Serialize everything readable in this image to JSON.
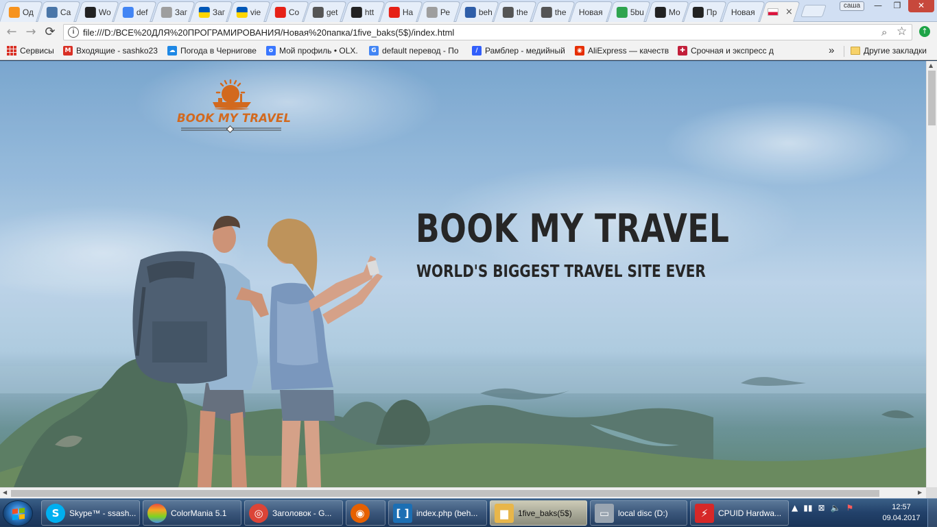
{
  "browser": {
    "tabs": [
      {
        "title": "Од",
        "icon": "odnoklassniki-icon",
        "color": "#f7931e"
      },
      {
        "title": "Са",
        "icon": "vk-icon",
        "color": "#4a76a8"
      },
      {
        "title": "Wo",
        "icon": "github-icon",
        "color": "#222222"
      },
      {
        "title": "def",
        "icon": "google-icon",
        "color": "#4285f4"
      },
      {
        "title": "Заг",
        "icon": "document-icon",
        "color": "#9e9e9e"
      },
      {
        "title": "Заг",
        "icon": "ukraine-flag-icon",
        "color": "#ffd500"
      },
      {
        "title": "vie",
        "icon": "ukraine-flag-icon",
        "color": "#ffd500"
      },
      {
        "title": "Со",
        "icon": "youtube-icon",
        "color": "#e62117"
      },
      {
        "title": "get",
        "icon": "w-mark-icon",
        "color": "#555555"
      },
      {
        "title": "htt",
        "icon": "github-icon",
        "color": "#222222"
      },
      {
        "title": "На",
        "icon": "youtube-icon",
        "color": "#e62117"
      },
      {
        "title": "Ре",
        "icon": "document-icon",
        "color": "#9e9e9e"
      },
      {
        "title": "beh",
        "icon": "audio-wave-icon",
        "color": "#2f5ea8"
      },
      {
        "title": "the",
        "icon": "w-mark-icon",
        "color": "#555555"
      },
      {
        "title": "the",
        "icon": "w-mark-icon",
        "color": "#555555"
      },
      {
        "title": "Новая",
        "icon": "",
        "color": ""
      },
      {
        "title": "5bu",
        "icon": "dollar-badge-icon",
        "color": "#2ea44f"
      },
      {
        "title": "Мо",
        "icon": "k-logo-icon",
        "color": "#222222"
      },
      {
        "title": "Пр",
        "icon": "k-logo-icon",
        "color": "#222222"
      },
      {
        "title": "Новая",
        "icon": "",
        "color": ""
      }
    ],
    "active_tab": {
      "icon": "poland-flag-icon",
      "close": "×"
    },
    "profile_button": "саша",
    "window_controls": {
      "minimize": "—",
      "restore": "❐",
      "close": "✕"
    },
    "nav": {
      "back": "←",
      "forward": "→",
      "reload": "⟳"
    },
    "address": {
      "url": "file:///D:/ВСЕ%20ДЛЯ%20ПРОГРАМИРОВАНИЯ/Новая%20папка/1five_baks(5$)/index.html",
      "info": "i",
      "zoom": "⌕",
      "star": "☆"
    },
    "extension": {
      "icon": "arrow-up-circle-icon",
      "glyph": "↑"
    },
    "bookmarks": [
      {
        "label": "Сервисы",
        "icon": "apps-icon",
        "color": "#d93025"
      },
      {
        "label": "Входящие - sashko23",
        "icon": "gmail-icon",
        "color": "#d93025",
        "glyph": "M"
      },
      {
        "label": "Погода в Чернигове",
        "icon": "weather-icon",
        "color": "#1e88e5",
        "glyph": "☁"
      },
      {
        "label": "Мой профиль • OLX.",
        "icon": "olx-icon",
        "color": "#3a77ff",
        "glyph": "o"
      },
      {
        "label": "default перевод - По",
        "icon": "google-icon",
        "color": "#4285f4",
        "glyph": "G"
      },
      {
        "label": "Рамблер - медийный",
        "icon": "rambler-icon",
        "color": "#315efb",
        "glyph": "/"
      },
      {
        "label": "AliExpress — качеств",
        "icon": "aliexpress-icon",
        "color": "#e62e04",
        "glyph": "◉"
      },
      {
        "label": "Срочная и экспресс д",
        "icon": "express-icon",
        "color": "#c21f3a",
        "glyph": "✚"
      }
    ],
    "bookmarks_overflow": "»",
    "other_bookmarks": "Другие закладки"
  },
  "page": {
    "logo_text": "BOOK MY TRAVEL",
    "hero_title": "BOOK MY TRAVEL",
    "hero_subtitle": "WORLD'S BIGGEST TRAVEL SITE EVER"
  },
  "taskbar": {
    "items": [
      {
        "label": "Skype™ - ssash...",
        "icon": "skype-icon",
        "color": "#00aff0",
        "glyph": "S"
      },
      {
        "label": "ColorMania 5.1",
        "icon": "colormania-icon",
        "color": "#e84b3c",
        "glyph": ""
      },
      {
        "label": "Заголовок - G...",
        "icon": "chrome-icon",
        "color": "#db4437",
        "glyph": "◎"
      },
      {
        "label": "",
        "icon": "firefox-icon",
        "color": "#e66000",
        "glyph": "◉"
      },
      {
        "label": "index.php (beh...",
        "icon": "brackets-icon",
        "color": "#1c6fb4",
        "glyph": "[ ]"
      },
      {
        "label": "1five_baks(5$)",
        "icon": "folder-icon",
        "color": "#e8b64a",
        "glyph": "▆"
      },
      {
        "label": "local disc (D:)",
        "icon": "drive-icon",
        "color": "#9aa5b1",
        "glyph": "▭"
      },
      {
        "label": "CPUID Hardwa...",
        "icon": "cpuid-icon",
        "color": "#d62828",
        "glyph": "⚡"
      }
    ],
    "tray_glyphs": [
      "▲",
      "▮▮",
      "⊠",
      "🔈",
      "⚑"
    ],
    "time": "12:57",
    "date": "09.04.2017"
  }
}
